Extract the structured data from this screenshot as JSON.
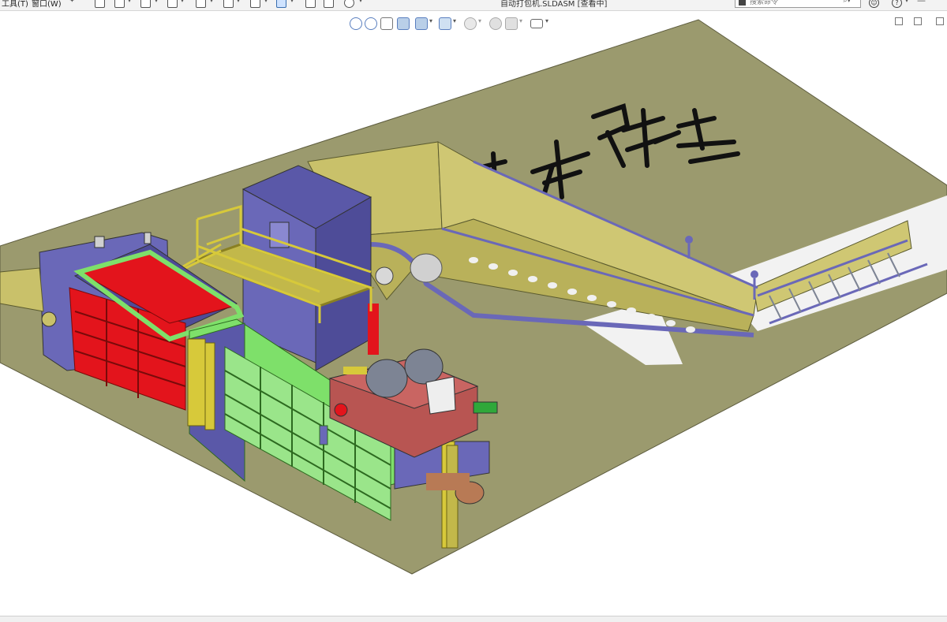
{
  "window": {
    "menu_tools": "工具(T)",
    "menu_window": "窗口(W)",
    "document_title": "自动打包机.SLDASM [查看中]"
  },
  "search": {
    "placeholder": "搜索命令"
  },
  "icons": {
    "home": "home-icon",
    "new_doc": "new-document-icon",
    "open": "open-icon",
    "save": "save-icon",
    "print": "print-icon",
    "undo": "undo-icon",
    "redo": "redo-icon",
    "select": "select-cursor-icon",
    "rebuild": "traffic-light-icon",
    "file_props": "file-properties-icon",
    "options": "gear-icon",
    "user": "user-icon",
    "help": "help-icon",
    "minimize": "minimize-icon",
    "zoom_fit": "zoom-to-fit-icon",
    "zoom_area": "zoom-area-icon",
    "previous_view": "previous-view-icon",
    "section_view": "section-view-icon",
    "view_orientation": "view-orientation-icon",
    "display_style": "display-style-icon",
    "hide_show": "hide-show-icon",
    "appearance": "edit-appearance-icon",
    "scene": "apply-scene-icon",
    "view_settings": "view-settings-icon"
  },
  "scene": {
    "floor_text": "杰哥",
    "colors": {
      "floor": "#9b9a6e",
      "frame": "#6a68b8",
      "press": "#e3141c",
      "cage": "#7ee06a",
      "conveyor": "#c9c16a",
      "rail": "#d7c93a",
      "hydraulic": "#b85552",
      "motor": "#7d8494"
    }
  }
}
